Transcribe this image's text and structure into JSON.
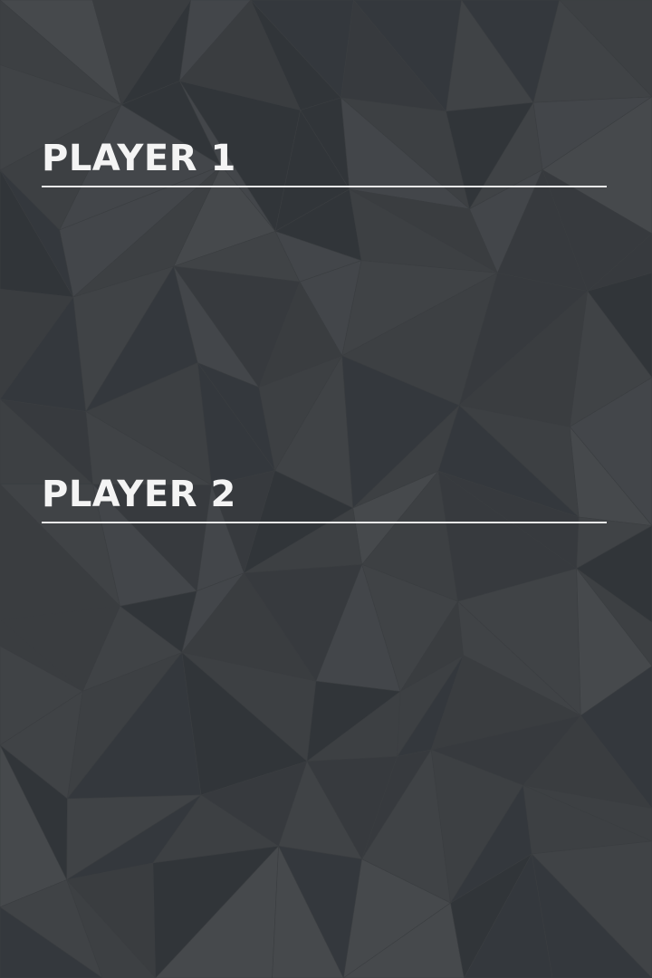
{
  "background": {
    "color": "#3d4043",
    "pattern": "low-poly-triangles"
  },
  "players": [
    {
      "title": "PLAYER 1"
    },
    {
      "title": "PLAYER 2"
    }
  ],
  "colors": {
    "title_text": "#f4f4f4",
    "divider": "#e9e9e9"
  }
}
